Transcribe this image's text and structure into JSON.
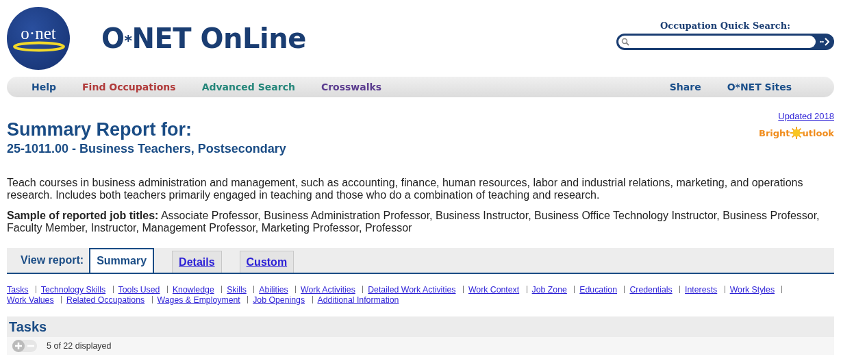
{
  "logo": {
    "badge_text": "o·net",
    "title_main": "O",
    "title_star": "*",
    "title_rest": "NET OnLine"
  },
  "quick_search": {
    "label": "Occupation Quick Search:"
  },
  "nav": {
    "left": [
      {
        "label": "Help",
        "color": "#1b4f8a"
      },
      {
        "label": "Find Occupations",
        "color": "#b03a3a"
      },
      {
        "label": "Advanced Search",
        "color": "#25867a"
      },
      {
        "label": "Crosswalks",
        "color": "#5b3c8f"
      }
    ],
    "right": [
      {
        "label": "Share",
        "color": "#1b4f8a"
      },
      {
        "label": "O*NET Sites",
        "color": "#1b4f8a"
      }
    ]
  },
  "report": {
    "title": "Summary Report for:",
    "occupation": "25-1011.00 - Business Teachers, Postsecondary",
    "updated": "Updated 2018",
    "bright_outlook": [
      "Bright",
      "utlook"
    ],
    "description": "Teach courses in business administration and management, such as accounting, finance, human resources, labor and industrial relations, marketing, and operations research. Includes both teachers primarily engaged in teaching and those who do a combination of teaching and research.",
    "sample_titles": "**Sample of reported job titles:** Associate Professor, Business Administration Professor, Business Instructor, Business Office Technology Instructor, Business Professor, Faculty Member, Instructor, Management Professor, Marketing Professor, Professor"
  },
  "view_report": {
    "label": "View report:",
    "tabs": [
      {
        "label": "Summary",
        "selected": true
      },
      {
        "label": "Details",
        "selected": false
      },
      {
        "label": "Custom",
        "selected": false
      }
    ]
  },
  "section_links": [
    "Tasks",
    "Technology Skills",
    "Tools Used",
    "Knowledge",
    "Skills",
    "Abilities",
    "Work Activities",
    "Detailed Work Activities",
    "Work Context",
    "Job Zone",
    "Education",
    "Credentials",
    "Interests",
    "Work Styles",
    "Work Values",
    "Related Occupations",
    "Wages & Employment",
    "Job Openings",
    "Additional Information"
  ],
  "tasks": {
    "title": "Tasks",
    "count": "5 of 22 displayed"
  }
}
